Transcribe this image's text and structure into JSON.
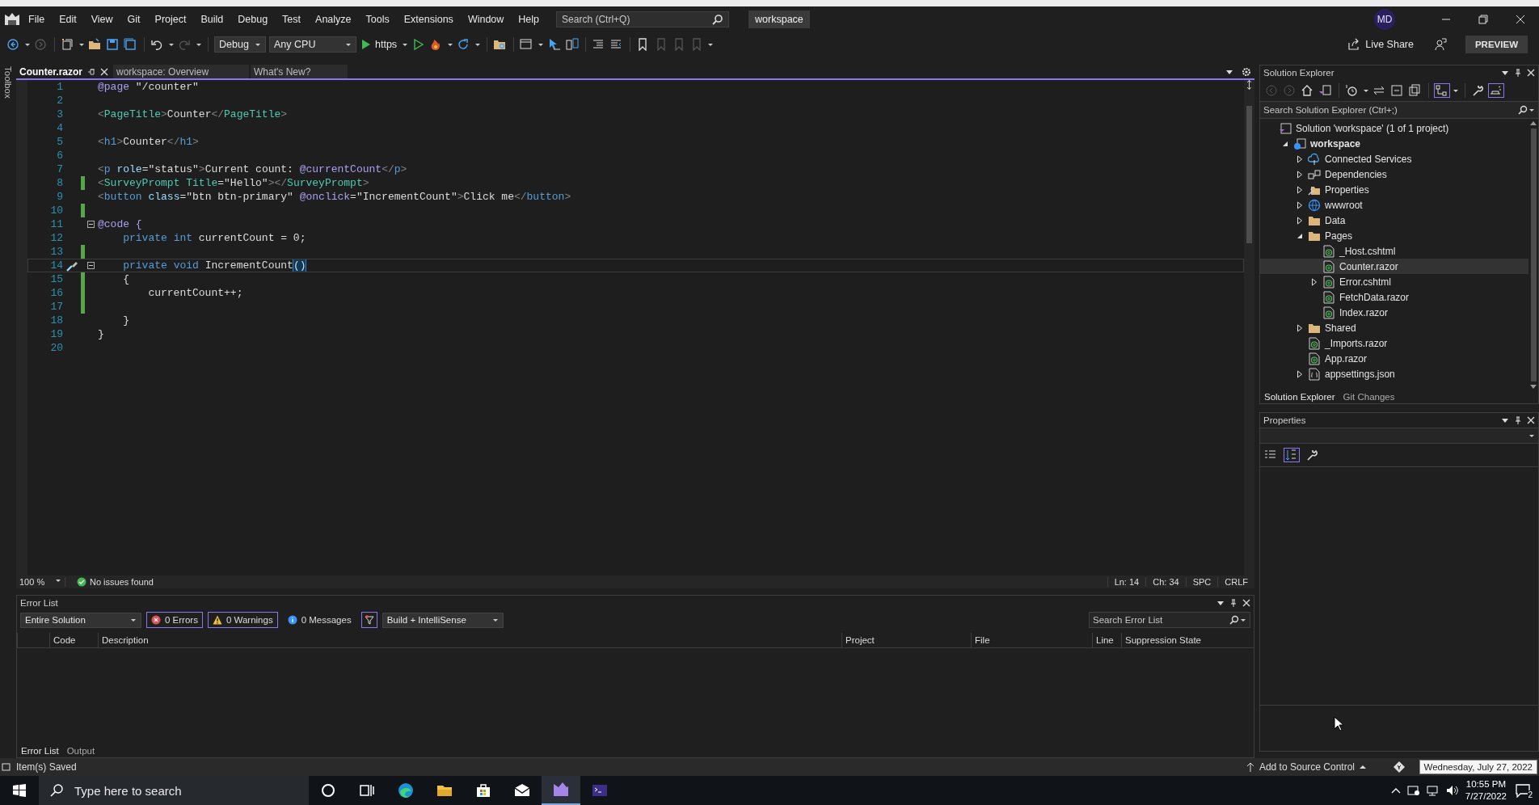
{
  "menu": [
    "File",
    "Edit",
    "View",
    "Git",
    "Project",
    "Build",
    "Debug",
    "Test",
    "Analyze",
    "Tools",
    "Extensions",
    "Window",
    "Help"
  ],
  "search": {
    "placeholder": "Search (Ctrl+Q)"
  },
  "solution_name": "workspace",
  "account": "MD",
  "toolbar": {
    "configuration": "Debug",
    "platform": "Any CPU",
    "run_target": "https"
  },
  "live_share": "Live Share",
  "preview": "PREVIEW",
  "toolbox": "Toolbox",
  "editor_tabs": [
    {
      "label": "Counter.razor",
      "selected": true
    },
    {
      "label": "workspace: Overview",
      "selected": false
    },
    {
      "label": "What's New?",
      "selected": false
    }
  ],
  "code_lines": [
    {
      "number": "1",
      "changed": false,
      "fold": false,
      "current": false,
      "tokens": [
        {
          "kind": "razor",
          "text": "@page"
        },
        {
          "kind": "text",
          "text": " \"/counter\""
        }
      ]
    },
    {
      "number": "2",
      "changed": false,
      "fold": false,
      "current": false
    },
    {
      "number": "3",
      "changed": false,
      "fold": false,
      "current": false,
      "tokens": [
        {
          "kind": "punct",
          "text": "<"
        },
        {
          "kind": "component",
          "text": "PageTitle"
        },
        {
          "kind": "punct",
          "text": ">"
        },
        {
          "kind": "text",
          "text": "Counter"
        },
        {
          "kind": "punct",
          "text": "</"
        },
        {
          "kind": "component",
          "text": "PageTitle"
        },
        {
          "kind": "punct",
          "text": ">"
        }
      ]
    },
    {
      "number": "4",
      "changed": false,
      "fold": false,
      "current": false
    },
    {
      "number": "5",
      "changed": false,
      "fold": false,
      "current": false,
      "tokens": [
        {
          "kind": "punct",
          "text": "<"
        },
        {
          "kind": "tag",
          "text": "h1"
        },
        {
          "kind": "punct",
          "text": ">"
        },
        {
          "kind": "text",
          "text": "Counter"
        },
        {
          "kind": "punct",
          "text": "</"
        },
        {
          "kind": "tag",
          "text": "h1"
        },
        {
          "kind": "punct",
          "text": ">"
        }
      ]
    },
    {
      "number": "6",
      "changed": false,
      "fold": false,
      "current": false
    },
    {
      "number": "7",
      "changed": false,
      "fold": false,
      "current": false,
      "tokens": [
        {
          "kind": "punct",
          "text": "<"
        },
        {
          "kind": "tag",
          "text": "p"
        },
        {
          "kind": "attr",
          "text": " role"
        },
        {
          "kind": "text",
          "text": "=\"status\""
        },
        {
          "kind": "punct",
          "text": ">"
        },
        {
          "kind": "text",
          "text": "Current count: "
        },
        {
          "kind": "razor",
          "text": "@currentCount"
        },
        {
          "kind": "punct",
          "text": "</"
        },
        {
          "kind": "tag",
          "text": "p"
        },
        {
          "kind": "punct",
          "text": ">"
        }
      ]
    },
    {
      "number": "8",
      "changed": true,
      "fold": false,
      "current": false,
      "tokens": [
        {
          "kind": "punct",
          "text": "<"
        },
        {
          "kind": "component",
          "text": "SurveyPrompt"
        },
        {
          "kind": "component",
          "text": " Title"
        },
        {
          "kind": "text",
          "text": "=\"Hello\""
        },
        {
          "kind": "punct",
          "text": "></"
        },
        {
          "kind": "component",
          "text": "SurveyPrompt"
        },
        {
          "kind": "punct",
          "text": ">"
        }
      ]
    },
    {
      "number": "9",
      "changed": false,
      "fold": false,
      "current": false,
      "tokens": [
        {
          "kind": "punct",
          "text": "<"
        },
        {
          "kind": "tag",
          "text": "button"
        },
        {
          "kind": "attr",
          "text": " class"
        },
        {
          "kind": "text",
          "text": "=\"btn btn-primary\" "
        },
        {
          "kind": "razor",
          "text": "@onclick"
        },
        {
          "kind": "text",
          "text": "=\"IncrementCount\""
        },
        {
          "kind": "punct",
          "text": ">"
        },
        {
          "kind": "text",
          "text": "Click me"
        },
        {
          "kind": "punct",
          "text": "</"
        },
        {
          "kind": "tag",
          "text": "button"
        },
        {
          "kind": "punct",
          "text": ">"
        }
      ]
    },
    {
      "number": "10",
      "changed": true,
      "fold": false,
      "current": false
    },
    {
      "number": "11",
      "changed": false,
      "fold": true,
      "current": false,
      "tokens": [
        {
          "kind": "razor",
          "text": "@code {"
        }
      ]
    },
    {
      "number": "12",
      "changed": false,
      "fold": false,
      "current": false,
      "tokens": [
        {
          "kind": "keyword",
          "text": "    private"
        },
        {
          "kind": "keyword",
          "text": " int"
        },
        {
          "kind": "text",
          "text": " currentCount = 0;"
        }
      ]
    },
    {
      "number": "13",
      "changed": true,
      "fold": false,
      "current": false
    },
    {
      "number": "14",
      "changed": false,
      "fold": true,
      "current": true,
      "tokens": [
        {
          "kind": "keyword",
          "text": "    private"
        },
        {
          "kind": "keyword",
          "text": " void"
        },
        {
          "kind": "text",
          "text": " IncrementCount"
        },
        {
          "kind": "match",
          "text": "()"
        }
      ]
    },
    {
      "number": "15",
      "changed": true,
      "fold": false,
      "current": false,
      "tokens": [
        {
          "kind": "text",
          "text": "    {"
        }
      ]
    },
    {
      "number": "16",
      "changed": true,
      "fold": false,
      "current": false,
      "tokens": [
        {
          "kind": "text",
          "text": "        currentCount++;"
        }
      ]
    },
    {
      "number": "17",
      "changed": true,
      "fold": false,
      "current": false
    },
    {
      "number": "18",
      "changed": false,
      "fold": false,
      "current": false,
      "tokens": [
        {
          "kind": "text",
          "text": "    }"
        }
      ]
    },
    {
      "number": "19",
      "changed": false,
      "fold": false,
      "current": false,
      "tokens": [
        {
          "kind": "text",
          "text": "}"
        }
      ]
    },
    {
      "number": "20",
      "changed": false,
      "fold": false,
      "current": false
    }
  ],
  "editor_status": {
    "zoom": "100 %",
    "issues": "No issues found",
    "line": "Ln: 14",
    "column": "Ch: 34",
    "whitespace": "SPC",
    "line_ending": "CRLF"
  },
  "error_list": {
    "title": "Error List",
    "scope": "Entire Solution",
    "filters": [
      {
        "kind": "error",
        "label": "0 Errors",
        "on": true
      },
      {
        "kind": "warning",
        "label": "0 Warnings",
        "on": true
      },
      {
        "kind": "info",
        "label": "0 Messages",
        "on": false
      }
    ],
    "source": "Build + IntelliSense",
    "search_placeholder": "Search Error List",
    "columns": [
      "Code",
      "Description",
      "Project",
      "File",
      "Line",
      "Suppression State"
    ],
    "tabs": [
      {
        "label": "Error List",
        "selected": true
      },
      {
        "label": "Output",
        "selected": false
      }
    ]
  },
  "solution_explorer": {
    "title": "Solution Explorer",
    "search_placeholder": "Search Solution Explorer (Ctrl+;)",
    "tree": [
      {
        "label": "Solution 'workspace' (1 of 1 project)",
        "kind": "solution",
        "selected": false,
        "children": [
          {
            "label": "workspace",
            "kind": "project",
            "selected": false,
            "expanded": true,
            "children": [
              {
                "label": "Connected Services",
                "kind": "services",
                "selected": false,
                "expanded": false
              },
              {
                "label": "Dependencies",
                "kind": "dependencies",
                "selected": false,
                "expanded": false
              },
              {
                "label": "Properties",
                "kind": "properties",
                "selected": false,
                "expanded": false
              },
              {
                "label": "wwwroot",
                "kind": "web",
                "selected": false,
                "expanded": false
              },
              {
                "label": "Data",
                "kind": "folder",
                "selected": false,
                "expanded": false
              },
              {
                "label": "Pages",
                "kind": "folder",
                "selected": false,
                "expanded": true,
                "children": [
                  {
                    "label": "_Host.cshtml",
                    "kind": "razor",
                    "selected": false
                  },
                  {
                    "label": "Counter.razor",
                    "kind": "razor",
                    "selected": true
                  },
                  {
                    "label": "Error.cshtml",
                    "kind": "razor",
                    "selected": false,
                    "expanded": false
                  },
                  {
                    "label": "FetchData.razor",
                    "kind": "razor",
                    "selected": false
                  },
                  {
                    "label": "Index.razor",
                    "kind": "razor",
                    "selected": false
                  }
                ]
              },
              {
                "label": "Shared",
                "kind": "folder",
                "selected": false,
                "expanded": false
              },
              {
                "label": "_Imports.razor",
                "kind": "razor",
                "selected": false
              },
              {
                "label": "App.razor",
                "kind": "razor",
                "selected": false
              },
              {
                "label": "appsettings.json",
                "kind": "json",
                "selected": false,
                "expanded": false
              }
            ]
          }
        ]
      }
    ],
    "tabs": [
      {
        "label": "Solution Explorer",
        "selected": true
      },
      {
        "label": "Git Changes",
        "selected": false
      }
    ]
  },
  "properties": {
    "title": "Properties"
  },
  "status_bar": {
    "message": "Item(s) Saved",
    "source_control": "Add to Source Control"
  },
  "tooltip": "Wednesday, July 27, 2022",
  "taskbar": {
    "search_placeholder": "Type here to search",
    "time": "10:55 PM",
    "date": "7/27/2022",
    "notifications": "2"
  }
}
